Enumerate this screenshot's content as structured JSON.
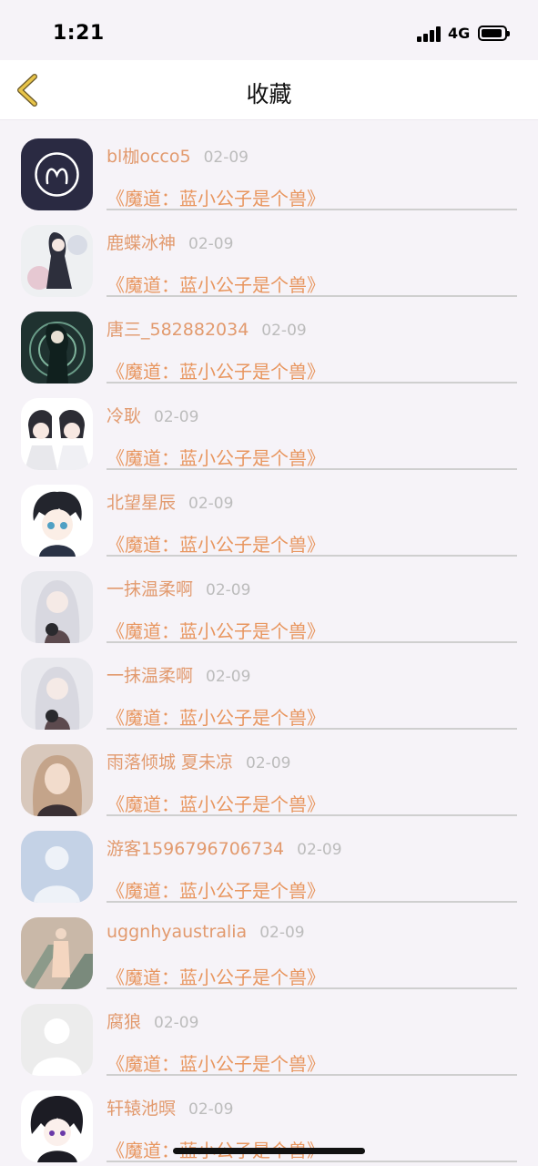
{
  "status": {
    "time": "1:21",
    "network": "4G"
  },
  "nav": {
    "title": "收藏",
    "back_icon": "chevron-left-icon"
  },
  "colors": {
    "name": "#e29a6e",
    "date": "#bcbcbc",
    "book": "#e8965f",
    "back_arrow": "#d8b53a"
  },
  "items": [
    {
      "name": "bl枷occo5",
      "date": "02-09",
      "book": "《魔道：蓝小公子是个兽》",
      "avatar_icon": "aries-icon"
    },
    {
      "name": "鹿蝶冰神",
      "date": "02-09",
      "book": "《魔道：蓝小公子是个兽》",
      "avatar_icon": "anime-girl-avatar"
    },
    {
      "name": "唐三_582882034",
      "date": "02-09",
      "book": "《魔道：蓝小公子是个兽》",
      "avatar_icon": "anime-portrait-avatar"
    },
    {
      "name": "冷耿",
      "date": "02-09",
      "book": "《魔道：蓝小公子是个兽》",
      "avatar_icon": "anime-couple-avatar"
    },
    {
      "name": "北望星辰",
      "date": "02-09",
      "book": "《魔道：蓝小公子是个兽》",
      "avatar_icon": "anime-boy-avatar"
    },
    {
      "name": "一抹温柔啊",
      "date": "02-09",
      "book": "《魔道：蓝小公子是个兽》",
      "avatar_icon": "white-hair-girl-avatar"
    },
    {
      "name": "一抹温柔啊",
      "date": "02-09",
      "book": "《魔道：蓝小公子是个兽》",
      "avatar_icon": "white-hair-girl-avatar"
    },
    {
      "name": "雨落倾城 夏未凉",
      "date": "02-09",
      "book": "《魔道：蓝小公子是个兽》",
      "avatar_icon": "photo-girl-avatar"
    },
    {
      "name": "游客1596796706734",
      "date": "02-09",
      "book": "《魔道：蓝小公子是个兽》",
      "avatar_icon": "default-user-avatar"
    },
    {
      "name": "uggnhyaustralia",
      "date": "02-09",
      "book": "《魔道：蓝小公子是个兽》",
      "avatar_icon": "escalator-photo-avatar"
    },
    {
      "name": "腐狼",
      "date": "02-09",
      "book": "《魔道：蓝小公子是个兽》",
      "avatar_icon": "grey-user-avatar"
    },
    {
      "name": "轩辕池暝",
      "date": "02-09",
      "book": "《魔道：蓝小公子是个兽》",
      "avatar_icon": "anime-dark-boy-avatar"
    }
  ]
}
